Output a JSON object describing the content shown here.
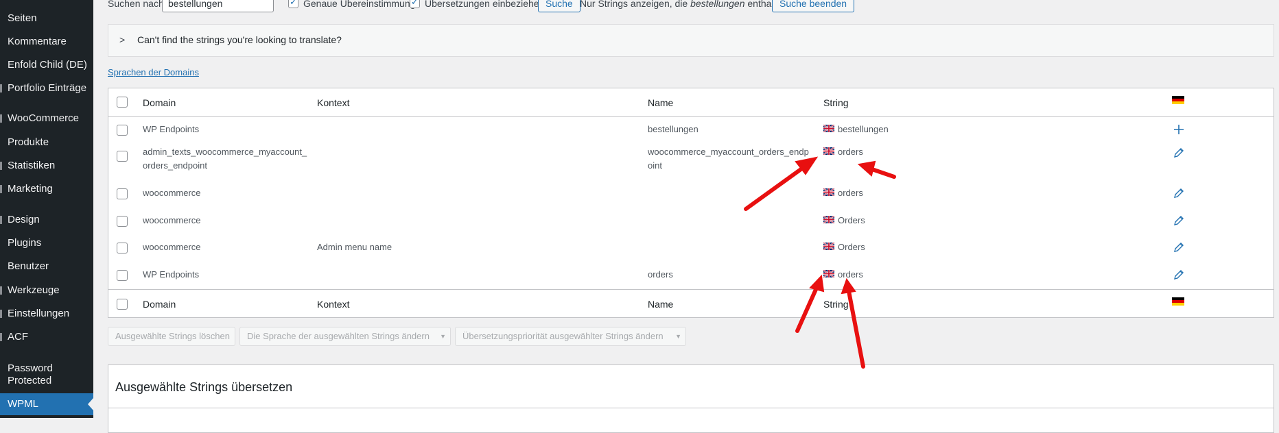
{
  "sidebar": {
    "items": [
      {
        "label": "Seiten"
      },
      {
        "label": "Kommentare"
      },
      {
        "label": "Enfold Child (DE)"
      },
      {
        "label": "Portfolio Einträge"
      },
      {
        "label": "WooCommerce"
      },
      {
        "label": "Produkte"
      },
      {
        "label": "Statistiken"
      },
      {
        "label": "Marketing"
      },
      {
        "label": "Design"
      },
      {
        "label": "Plugins"
      },
      {
        "label": "Benutzer"
      },
      {
        "label": "Werkzeuge"
      },
      {
        "label": "Einstellungen"
      },
      {
        "label": "ACF"
      },
      {
        "label": "Password"
      },
      {
        "label": "Protected"
      },
      {
        "label": "WPML"
      }
    ]
  },
  "search": {
    "label": "Suchen nach:",
    "value": "bestellungen",
    "exact_match_label": "Genaue Übereinstimmung",
    "include_translations_label": "Übersetzungen einbeziehen",
    "search_button": "Suche",
    "result_text_pre": "Nur Strings anzeigen, die",
    "result_term": "bestellungen",
    "result_text_post": "enthalten",
    "end_search_button": "Suche beenden"
  },
  "notice": {
    "text": "Can't find the strings you're looking to translate?"
  },
  "domains_link": "Sprachen der Domains",
  "table": {
    "headers": {
      "domain": "Domain",
      "context": "Kontext",
      "name": "Name",
      "string": "String"
    },
    "rows": [
      {
        "domain": "WP Endpoints",
        "context": "",
        "name": "bestellungen",
        "string": "bestellungen",
        "action": "plus-icon"
      },
      {
        "domain": "admin_texts_woocommerce_myaccount_",
        "domain2": "orders_endpoint",
        "context": "",
        "name": "woocommerce_myaccount_orders_endp",
        "name2": "oint",
        "string": "orders",
        "action": "pencil-icon"
      },
      {
        "domain": "woocommerce",
        "context": "",
        "name": "",
        "string": "orders",
        "action": "pencil-icon"
      },
      {
        "domain": "woocommerce",
        "context": "",
        "name": "",
        "string": "Orders",
        "action": "pencil-icon"
      },
      {
        "domain": "woocommerce",
        "context": "Admin menu name",
        "name": "",
        "string": "Orders",
        "action": "pencil-icon"
      },
      {
        "domain": "WP Endpoints",
        "context": "",
        "name": "orders",
        "string": "orders",
        "action": "pencil-icon"
      }
    ]
  },
  "bulk_actions": {
    "delete": "Ausgewählte Strings löschen",
    "change_language": "Die Sprache der ausgewählten Strings ändern",
    "change_priority": "Übersetzungspriorität ausgewählter Strings ändern"
  },
  "translate_panel": {
    "title": "Ausgewählte Strings übersetzen"
  },
  "colors": {
    "accent": "#2271b1",
    "sidebar": "#1d2327",
    "annotation": "#e81010"
  }
}
